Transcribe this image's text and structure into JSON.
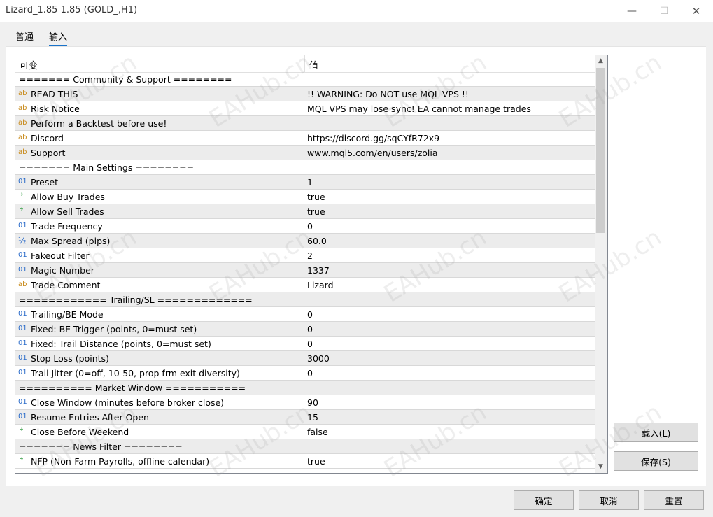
{
  "window": {
    "title": "Lizard_1.85 1.85 (GOLD_,H1)",
    "minimize_glyph": "—",
    "maximize_glyph": "☐",
    "close_glyph": "✕"
  },
  "tabs": [
    {
      "label": "普通"
    },
    {
      "label": "输入"
    }
  ],
  "active_tab": "输入",
  "grid": {
    "col_variable": "可变",
    "col_value": "值",
    "rows": [
      {
        "type": "section",
        "name": "======= Community & Support ========",
        "value": ""
      },
      {
        "type": "ab",
        "name": "READ THIS",
        "value": "!! WARNING: Do NOT use MQL VPS !!"
      },
      {
        "type": "ab",
        "name": "Risk Notice",
        "value": "MQL VPS may lose sync! EA cannot manage trades"
      },
      {
        "type": "ab",
        "name": "Perform a Backtest before use!",
        "value": ""
      },
      {
        "type": "ab",
        "name": "Discord",
        "value": "https://discord.gg/sqCYfR72x9"
      },
      {
        "type": "ab",
        "name": "Support",
        "value": "www.mql5.com/en/users/zolia"
      },
      {
        "type": "section",
        "name": "======= Main Settings ========",
        "value": ""
      },
      {
        "type": "int",
        "name": "Preset",
        "value": "1"
      },
      {
        "type": "bool",
        "name": "Allow Buy Trades",
        "value": "true"
      },
      {
        "type": "bool",
        "name": "Allow Sell Trades",
        "value": "true"
      },
      {
        "type": "int",
        "name": "Trade Frequency",
        "value": "0"
      },
      {
        "type": "double",
        "name": "Max Spread (pips)",
        "value": "60.0"
      },
      {
        "type": "int",
        "name": "Fakeout Filter",
        "value": "2"
      },
      {
        "type": "int",
        "name": "Magic Number",
        "value": "1337"
      },
      {
        "type": "ab",
        "name": "Trade Comment",
        "value": "Lizard"
      },
      {
        "type": "section",
        "name": "============ Trailing/SL =============",
        "value": ""
      },
      {
        "type": "int",
        "name": "Trailing/BE Mode",
        "value": "0"
      },
      {
        "type": "int",
        "name": "Fixed: BE Trigger (points, 0=must set)",
        "value": "0"
      },
      {
        "type": "int",
        "name": "Fixed: Trail Distance (points, 0=must set)",
        "value": "0"
      },
      {
        "type": "int",
        "name": "Stop Loss (points)",
        "value": "3000"
      },
      {
        "type": "int",
        "name": "Trail Jitter (0=off, 10-50, prop frm exit diversity)",
        "value": "0"
      },
      {
        "type": "section",
        "name": "========== Market Window ===========",
        "value": ""
      },
      {
        "type": "int",
        "name": "Close Window (minutes before broker close)",
        "value": "90"
      },
      {
        "type": "int",
        "name": "Resume Entries After Open",
        "value": "15"
      },
      {
        "type": "bool",
        "name": "Close Before Weekend",
        "value": "false"
      },
      {
        "type": "section",
        "name": "======= News Filter ========",
        "value": ""
      },
      {
        "type": "bool",
        "name": "NFP (Non-Farm Payrolls, offline calendar)",
        "value": "true"
      }
    ]
  },
  "type_icons": {
    "ab": "ab",
    "int": "01",
    "double": "½",
    "bool": "↱"
  },
  "icon_colors": {
    "ab": "#c88a1a",
    "int": "#2a6bc9",
    "double": "#2a6bc9",
    "bool": "#2e9a3e"
  },
  "scrollbar": {
    "up_glyph": "▲",
    "down_glyph": "▼"
  },
  "side_buttons": {
    "load": "载入(L)",
    "save": "保存(S)"
  },
  "footer_buttons": {
    "ok": "确定",
    "cancel": "取消",
    "reset": "重置"
  },
  "watermark_text": "EAHub.cn"
}
